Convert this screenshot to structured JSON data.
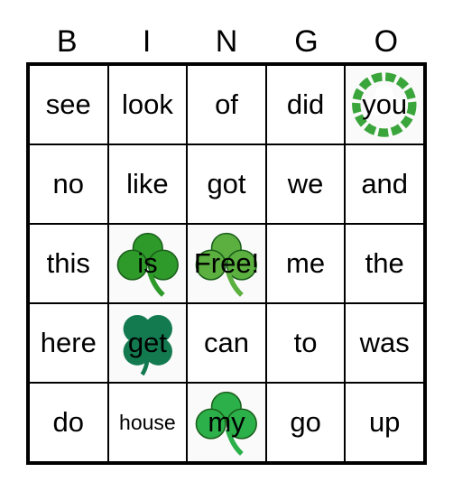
{
  "header": [
    "B",
    "I",
    "N",
    "G",
    "O"
  ],
  "cells": [
    [
      {
        "word": "see"
      },
      {
        "word": "look"
      },
      {
        "word": "of"
      },
      {
        "word": "did"
      },
      {
        "word": "you",
        "icon": "shamrock-wreath-icon",
        "color": "#3aa53a"
      }
    ],
    [
      {
        "word": "no"
      },
      {
        "word": "like"
      },
      {
        "word": "got"
      },
      {
        "word": "we"
      },
      {
        "word": "and"
      }
    ],
    [
      {
        "word": "this"
      },
      {
        "word": "is",
        "icon": "shamrock-icon",
        "color": "#2e9a2a"
      },
      {
        "word": "Free!",
        "icon": "shamrock-icon",
        "color": "#5cb040"
      },
      {
        "word": "me"
      },
      {
        "word": "the"
      }
    ],
    [
      {
        "word": "here"
      },
      {
        "word": "get",
        "icon": "four-leaf-clover-icon",
        "color": "#137a50"
      },
      {
        "word": "can"
      },
      {
        "word": "to"
      },
      {
        "word": "was"
      }
    ],
    [
      {
        "word": "do"
      },
      {
        "word": "house"
      },
      {
        "word": "my",
        "icon": "shamrock-icon",
        "color": "#2bb04a"
      },
      {
        "word": "go"
      },
      {
        "word": "up"
      }
    ]
  ]
}
